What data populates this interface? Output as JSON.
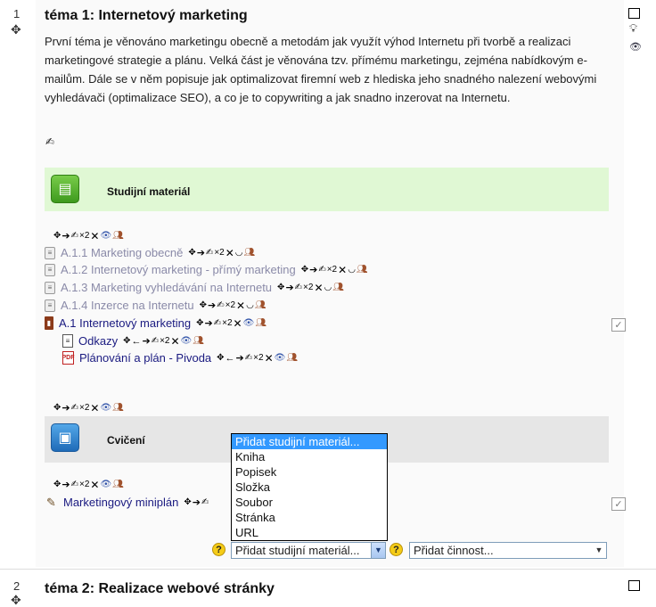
{
  "section1": {
    "number": "1",
    "title": "téma 1: Internetový marketing",
    "summary": "První téma je věnováno marketingu obecně a metodám jak využít výhod Internetu při tvorbě a realizaci marketingové strategie a plánu.  Velká část je věnována tzv. přímému marketingu, zejména nabídkovým e-mailům. Dále se v něm popisuje jak optimalizovat firemní web z hlediska jeho snadného nalezení webovými vyhledávači (optimalizace SEO), a co je to copywriting  a jak snadno inzerovat na Internetu.",
    "label1": "Studijní materiál",
    "label2": "Cvičení",
    "activities": [
      {
        "name": "A.1.1 Marketing obecně",
        "icon": "page-icon",
        "hidden": true
      },
      {
        "name": "A.1.2 Internetový marketing - přímý marketing",
        "icon": "page-icon",
        "hidden": true
      },
      {
        "name": "A.1.3 Marketing vyhledávání na Internetu",
        "icon": "page-icon",
        "hidden": true
      },
      {
        "name": "A.1.4 Inzerce na Internetu",
        "icon": "page-icon",
        "hidden": true
      },
      {
        "name": "A.1 Internetový marketing",
        "icon": "book-icon",
        "hidden": false
      },
      {
        "name": "Odkazy",
        "icon": "document-icon",
        "hidden": false
      },
      {
        "name": "Plánování a plán - Pivoda",
        "icon": "pdf-icon",
        "hidden": false
      },
      {
        "name": "Marketingový miniplán",
        "icon": "workshop-icon",
        "hidden": false
      }
    ],
    "edit_icon_count": "×2"
  },
  "add_resource": {
    "selected": "Přidat studijní materiál...",
    "options": [
      "Přidat studijní materiál...",
      "Kniha",
      "Popisek",
      "Složka",
      "Soubor",
      "Stránka",
      "URL"
    ],
    "highlighted_index": 0
  },
  "add_activity": {
    "selected": "Přidat činnost..."
  },
  "section2": {
    "number": "2",
    "title": "téma 2: Realizace webové stránky"
  },
  "colors": {
    "label_green": "#e0f8d4",
    "label_gray": "#e6e6e6",
    "link_dim": "#8a8aa8",
    "link_normal": "#1a1a80",
    "highlight": "#3399ff"
  }
}
